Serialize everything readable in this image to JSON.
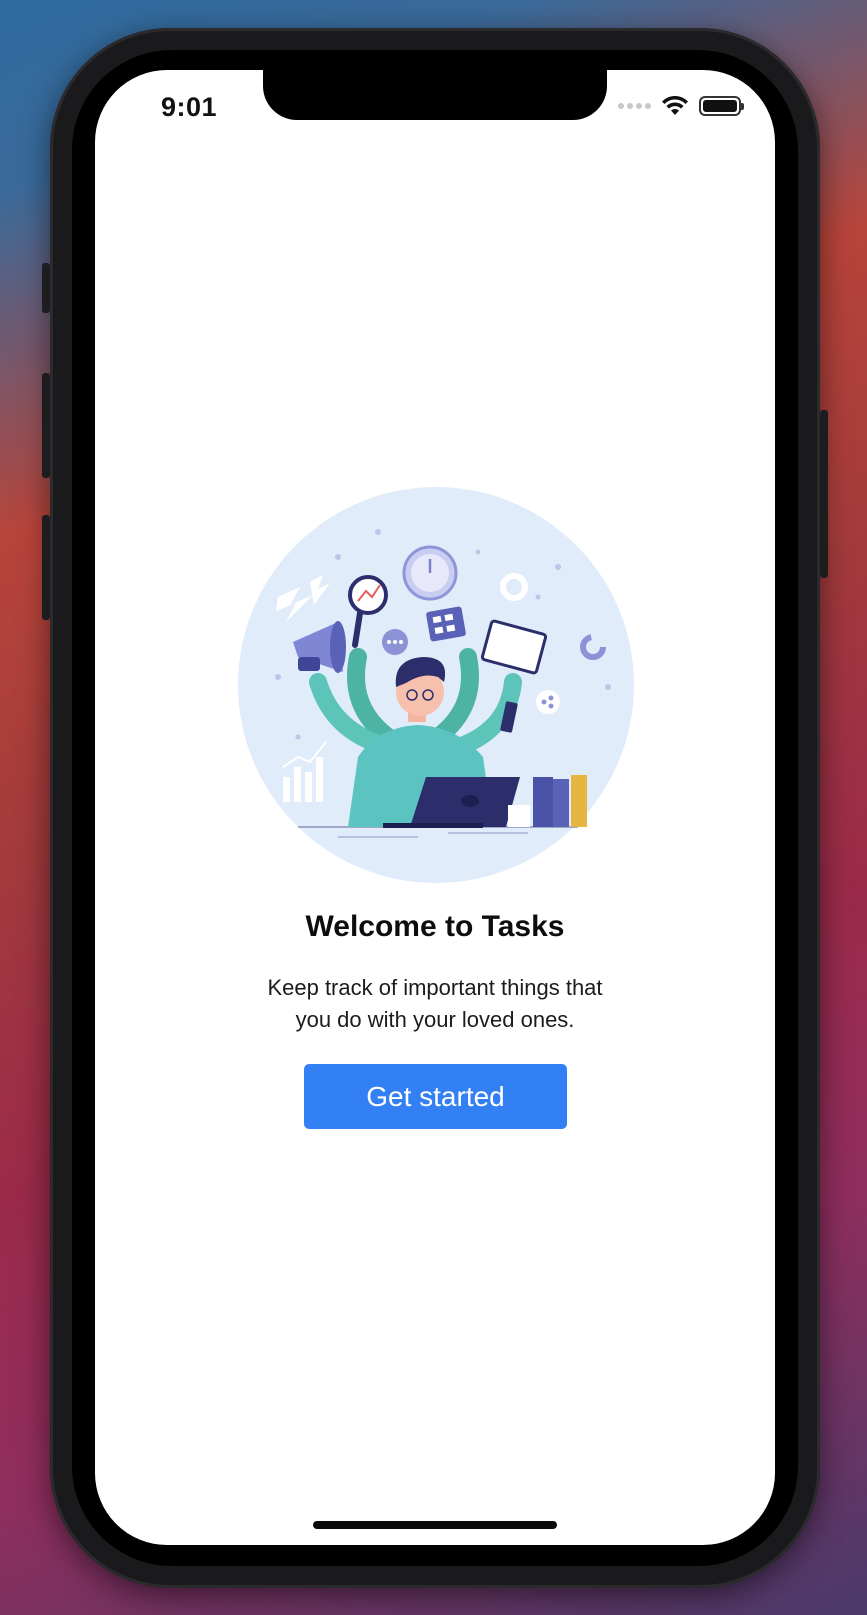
{
  "status_bar": {
    "time": "9:01",
    "icons": [
      "cellular-signal-icon",
      "wifi-icon",
      "battery-icon"
    ]
  },
  "onboarding": {
    "title": "Welcome to Tasks",
    "subtitle_line1": "Keep track of important things that",
    "subtitle_line2": "you do with your loved ones.",
    "cta_label": "Get started"
  },
  "colors": {
    "accent": "#3380f5",
    "illustration_bg": "#e1ecfb"
  }
}
